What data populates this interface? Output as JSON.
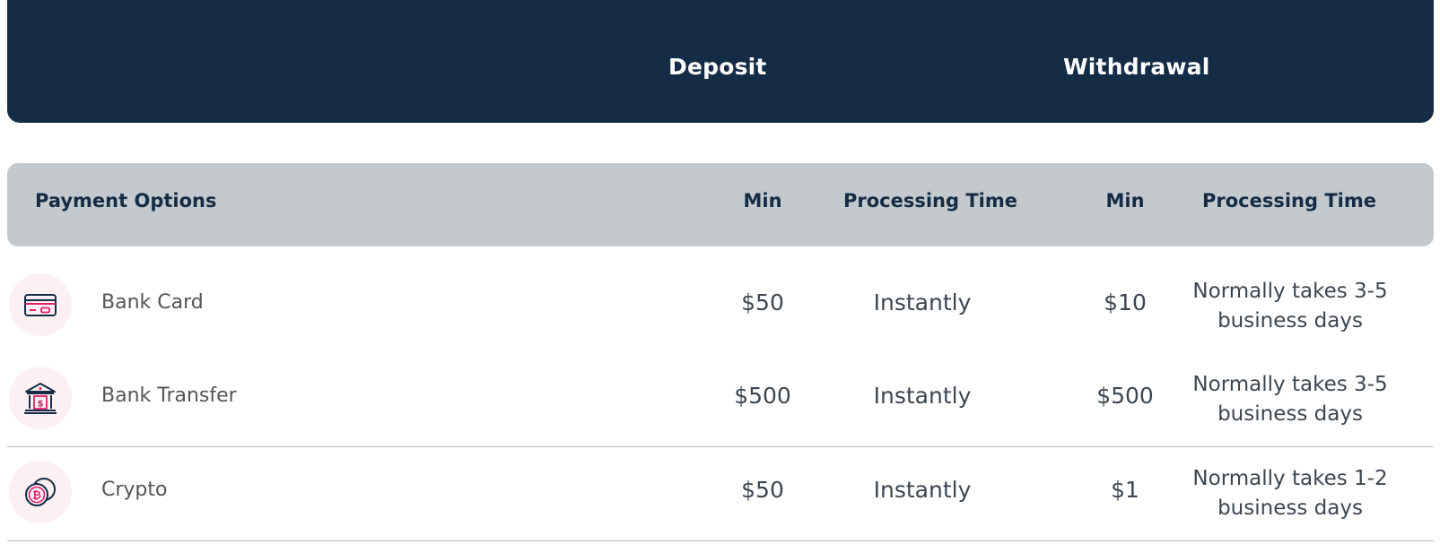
{
  "top_header": {
    "deposit_label": "Deposit",
    "withdrawal_label": "Withdrawal",
    "background_color": "#142c45"
  },
  "column_headers": {
    "payment_options": "Payment Options",
    "deposit_min": "Min",
    "deposit_processing_time": "Processing Time",
    "withdrawal_min": "Min",
    "withdrawal_processing_time": "Processing Time",
    "background_color": "#c4c9ce"
  },
  "rows": [
    {
      "icon": "credit-card-icon",
      "name": "Bank Card",
      "deposit_min": "$50",
      "deposit_time": "Instantly",
      "withdrawal_min": "$10",
      "withdrawal_time": "Normally takes 3-5 business days"
    },
    {
      "icon": "bank-icon",
      "name": "Bank Transfer",
      "deposit_min": "$500",
      "deposit_time": "Instantly",
      "withdrawal_min": "$500",
      "withdrawal_time": "Normally takes 3-5 business days"
    },
    {
      "icon": "bitcoin-coins-icon",
      "name": "Crypto",
      "deposit_min": "$50",
      "deposit_time": "Instantly",
      "withdrawal_min": "$1",
      "withdrawal_time": "Normally takes 1-2 business days"
    }
  ],
  "colors": {
    "icon_accent": "#e0206a",
    "icon_stroke": "#142c45",
    "icon_background": "#fdf0f3"
  }
}
